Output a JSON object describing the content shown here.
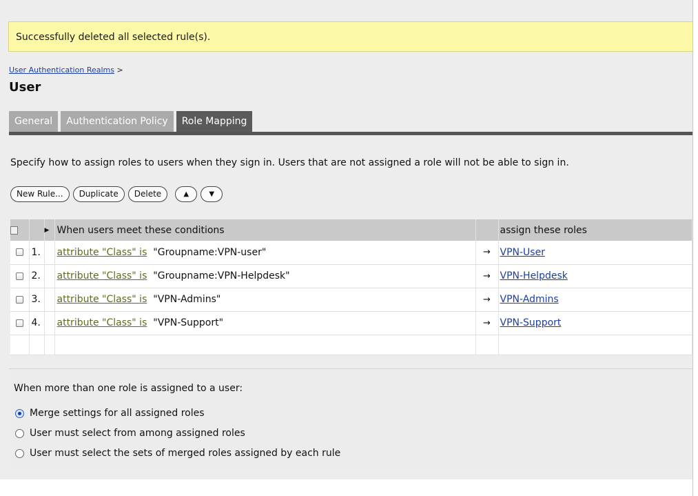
{
  "notice": {
    "text": "Successfully deleted all selected rule(s)."
  },
  "breadcrumb": {
    "link": "User Authentication Realms",
    "separator": ">"
  },
  "page": {
    "title": "User"
  },
  "tabs": [
    {
      "label": "General",
      "active": false
    },
    {
      "label": "Authentication Policy",
      "active": false
    },
    {
      "label": "Role Mapping",
      "active": true
    }
  ],
  "instructions": "Specify how to assign roles to users when they sign in. Users that are not assigned a role will not be able to sign in.",
  "toolbar": {
    "new_rule": "New Rule...",
    "duplicate": "Duplicate",
    "delete": "Delete",
    "move_up_icon": "arrow-up-icon",
    "move_down_icon": "arrow-down-icon"
  },
  "table": {
    "header_conditions": "When users meet these conditions",
    "header_roles": "assign these roles",
    "rows": [
      {
        "num": "1.",
        "condition_link": "attribute \"Class\" is",
        "condition_value": "\"Groupname:VPN-user\"",
        "arrow": "→",
        "role": "VPN-User"
      },
      {
        "num": "2.",
        "condition_link": "attribute \"Class\" is",
        "condition_value": "\"Groupname:VPN-Helpdesk\"",
        "arrow": "→",
        "role": "VPN-Helpdesk"
      },
      {
        "num": "3.",
        "condition_link": "attribute \"Class\" is",
        "condition_value": "\"VPN-Admins\"",
        "arrow": "→",
        "role": "VPN-Admins"
      },
      {
        "num": "4.",
        "condition_link": "attribute \"Class\" is",
        "condition_value": "\"VPN-Support\"",
        "arrow": "→",
        "role": "VPN-Support"
      }
    ]
  },
  "merge": {
    "title": "When more than one role is assigned to a user:",
    "options": [
      {
        "label": "Merge settings for all assigned roles",
        "selected": true
      },
      {
        "label": "User must select from among assigned roles",
        "selected": false
      },
      {
        "label": "User must select the sets of merged roles assigned by each rule",
        "selected": false
      }
    ]
  }
}
